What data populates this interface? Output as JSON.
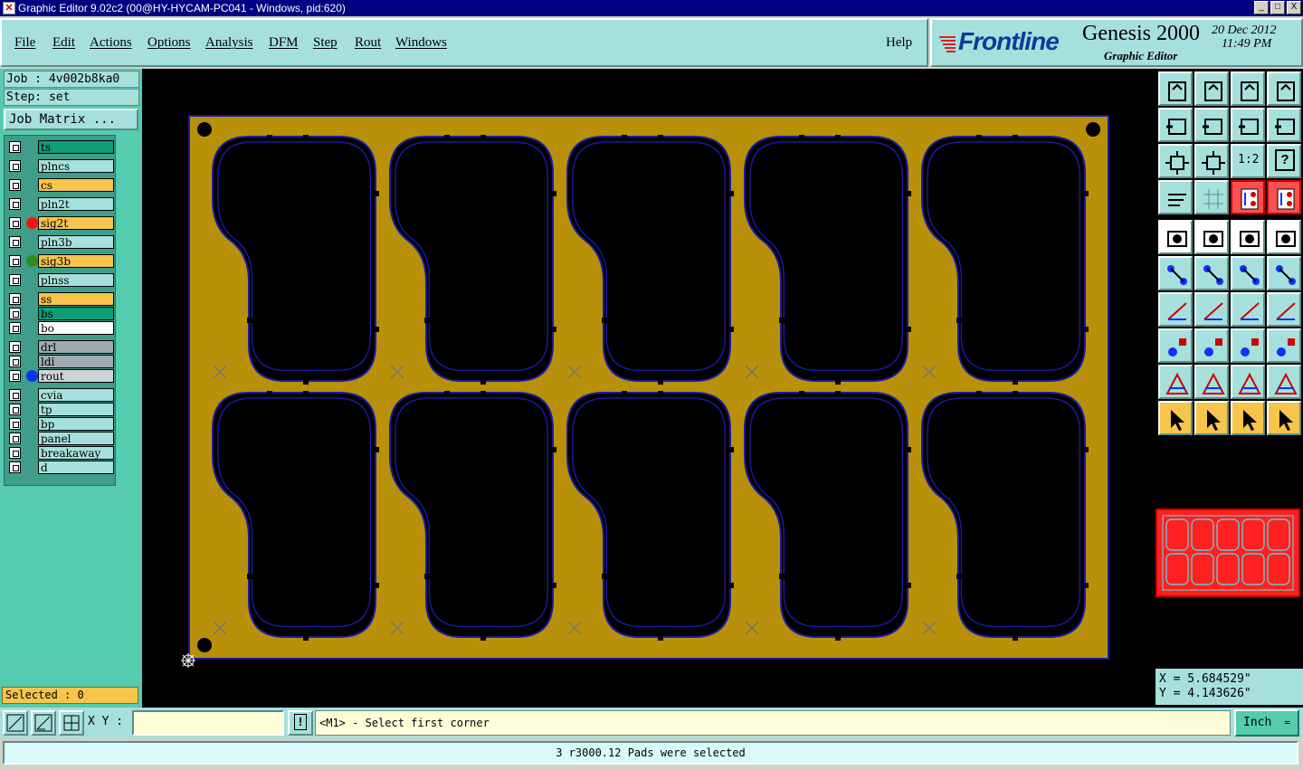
{
  "window": {
    "title": "Graphic Editor 9.02c2 (00@HY-HYCAM-PC041 - Windows, pid:620)",
    "buttons": [
      "_",
      "□",
      "X"
    ]
  },
  "menu": {
    "file": "File",
    "edit": "Edit",
    "actions": "Actions",
    "options": "Options",
    "analysis": "Analysis",
    "dfm": "DFM",
    "step": "Step",
    "rout": "Rout",
    "windows": "Windows",
    "help": "Help"
  },
  "brand": {
    "logo": "Frontline",
    "product": "Genesis 2000",
    "subtitle": "Graphic Editor",
    "date": "20 Dec 2012",
    "time": "11:49 PM"
  },
  "job": {
    "job_label": "Job : 4v002b8ka0",
    "step_label": "Step: set",
    "matrix_button": "Job Matrix ..."
  },
  "layers": [
    {
      "name": "ts",
      "color": "#0e9e78",
      "dot": ""
    },
    {
      "name": "plncs",
      "color": "#a6e0dc",
      "dot": ""
    },
    {
      "name": "cs",
      "color": "#f7c44c",
      "dot": ""
    },
    {
      "name": "pln2t",
      "color": "#a6e0dc",
      "dot": ""
    },
    {
      "name": "sig2t",
      "color": "#f7c44c",
      "dot": "#ff1010"
    },
    {
      "name": "pln3b",
      "color": "#a6e0dc",
      "dot": ""
    },
    {
      "name": "sig3b",
      "color": "#f7c44c",
      "dot": "#2e8c22"
    },
    {
      "name": "plnss",
      "color": "#a6e0dc",
      "dot": ""
    },
    {
      "name": "ss",
      "color": "#f7c44c",
      "dot": ""
    },
    {
      "name": "bs",
      "color": "#0e9e78",
      "dot": ""
    },
    {
      "name": "bo",
      "color": "#ffffff",
      "dot": ""
    },
    {
      "name": "drl",
      "color": "#a0aab0",
      "dot": ""
    },
    {
      "name": "ldi",
      "color": "#a0aab0",
      "dot": ""
    },
    {
      "name": "rout",
      "color": "#d0d4d8",
      "dot": "#1030ff"
    },
    {
      "name": "cvia",
      "color": "#a6e0dc",
      "dot": ""
    },
    {
      "name": "tp",
      "color": "#a6e0dc",
      "dot": ""
    },
    {
      "name": "bp",
      "color": "#a6e0dc",
      "dot": ""
    },
    {
      "name": "panel",
      "color": "#a6e0dc",
      "dot": ""
    },
    {
      "name": "breakaway",
      "color": "#a6e0dc",
      "dot": ""
    },
    {
      "name": "d",
      "color": "#a6e0dc",
      "dot": ""
    }
  ],
  "selected_label": "Selected : 0",
  "tools": {
    "zoom_ratio_label": "1:2",
    "help_label": "?"
  },
  "coords": {
    "x": "X = 5.684529\"",
    "y": "Y = 4.143626\""
  },
  "bottom": {
    "xy_label": "X Y :",
    "xy_value": "",
    "alert_label": "!",
    "prompt": "<M1> - Select first corner",
    "units": "Inch"
  },
  "status": "3 r3000.12 Pads were selected",
  "colors": {
    "panel_fill": "#b8900a",
    "outline": "#1a1aa0",
    "background": "#000000"
  }
}
